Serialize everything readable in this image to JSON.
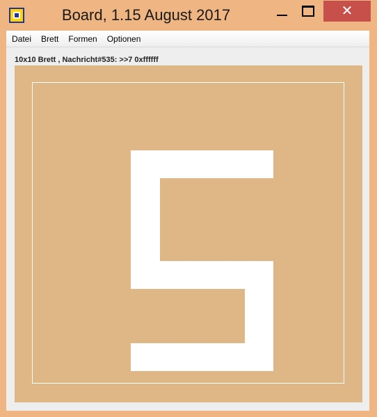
{
  "window": {
    "title": "Board, 1.15 August 2017",
    "icon": "board-app-icon",
    "controls": {
      "minimize_icon": "minimize-icon",
      "maximize_icon": "maximize-icon",
      "close_icon": "close-icon",
      "close_glyph": "✕"
    }
  },
  "menu": {
    "items": [
      {
        "label": "Datei"
      },
      {
        "label": "Brett"
      },
      {
        "label": "Formen"
      },
      {
        "label": "Optionen"
      }
    ]
  },
  "status": {
    "text": "10x10 Brett , Nachricht#535: >>7 0xffffff"
  },
  "board": {
    "grid_size": "10x10",
    "background_color": "#dfb787",
    "foreground_color": "#ffffff",
    "displayed_glyph": "5"
  },
  "colors": {
    "titlebar": "#efb582",
    "close_button": "#c7504a"
  }
}
